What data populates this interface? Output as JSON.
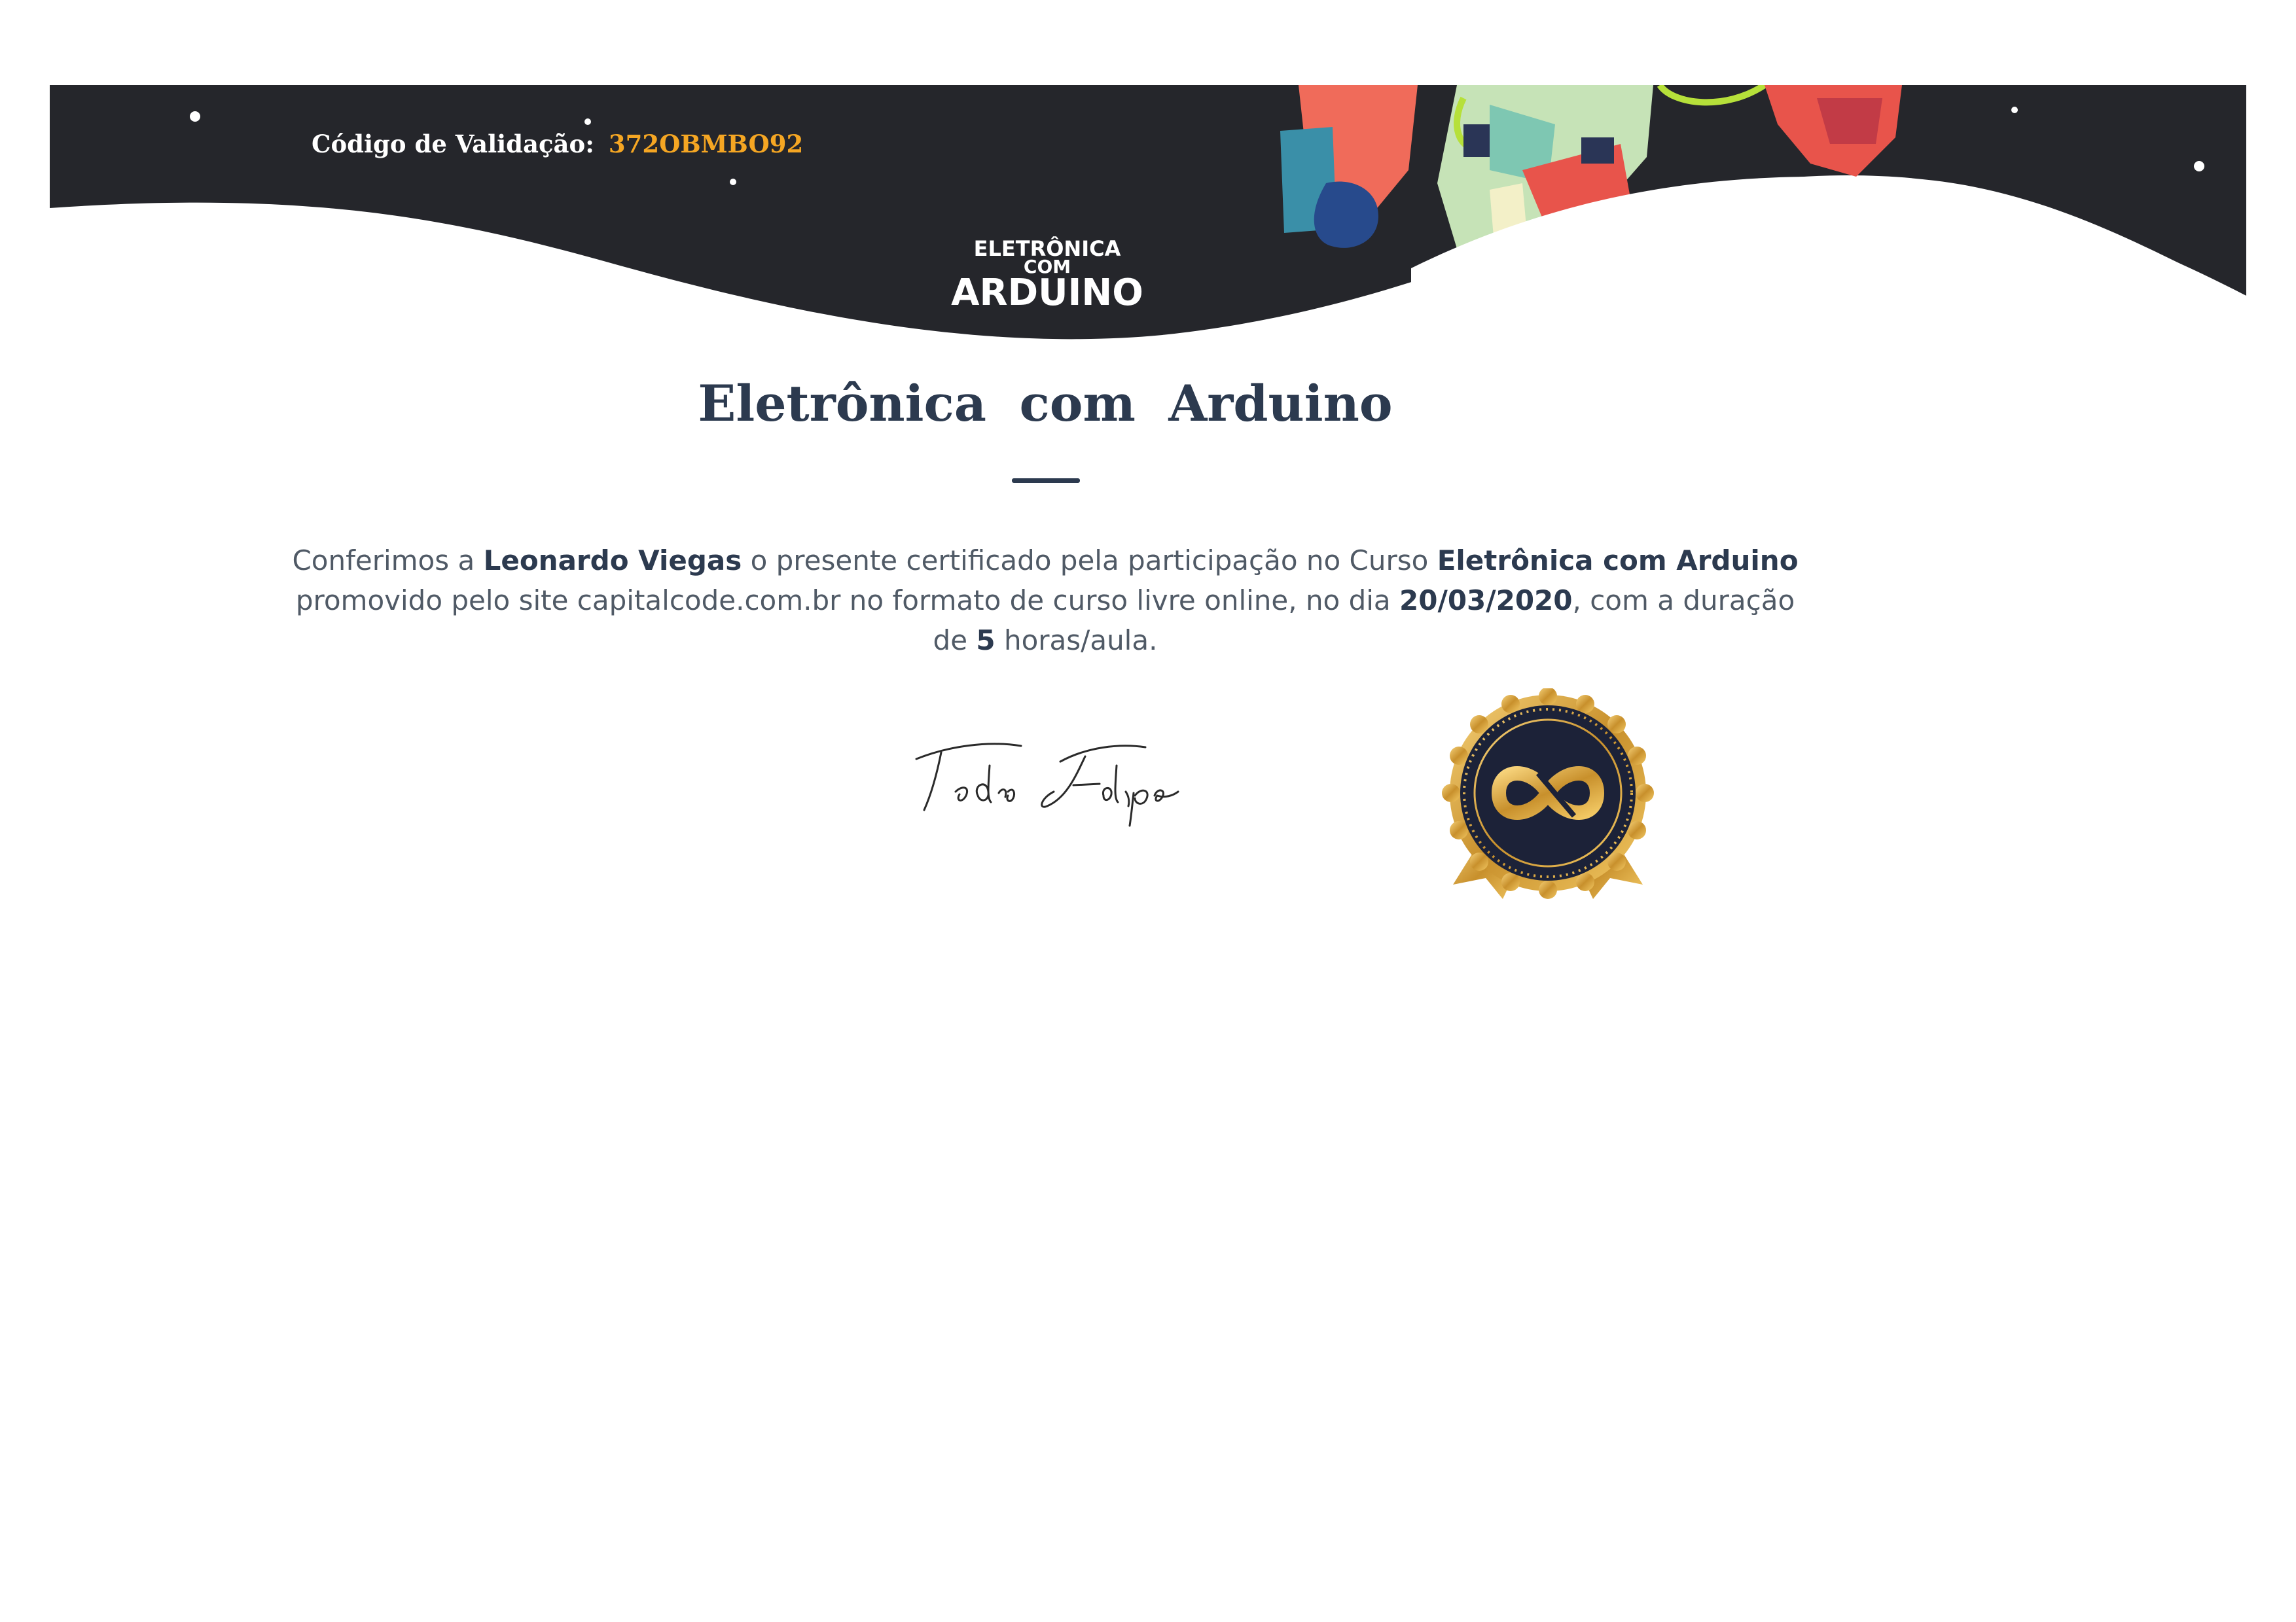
{
  "header": {
    "validation_label": "Código  de  Validação:",
    "validation_code": "372OBMBO92",
    "logo": {
      "line1": "ELETRÔNICA",
      "line2": "COM",
      "line3": "ARDUINO"
    },
    "colors": {
      "banner_bg": "#25262b",
      "code": "#f5a623"
    }
  },
  "certificate": {
    "title": "Eletrônica com Arduino",
    "intro": "Conferimos a ",
    "student_name": "Leonardo Viegas",
    "middle": " o presente certificado pela participação no Curso ",
    "course_name": "Eletrônica com Arduino",
    "promo": " promovido pelo site capitalcode.com.br no formato de curso livre online, no dia ",
    "date": "20/03/2020",
    "duration_prefix": ", com a duração de ",
    "hours": "5",
    "duration_suffix": " horas/aula."
  },
  "signature": {
    "text": "Pedro Felipe"
  },
  "seal": {
    "icon": "infinity-icon",
    "colors": {
      "gold": "#d9a53a",
      "navy": "#1c2238"
    }
  }
}
